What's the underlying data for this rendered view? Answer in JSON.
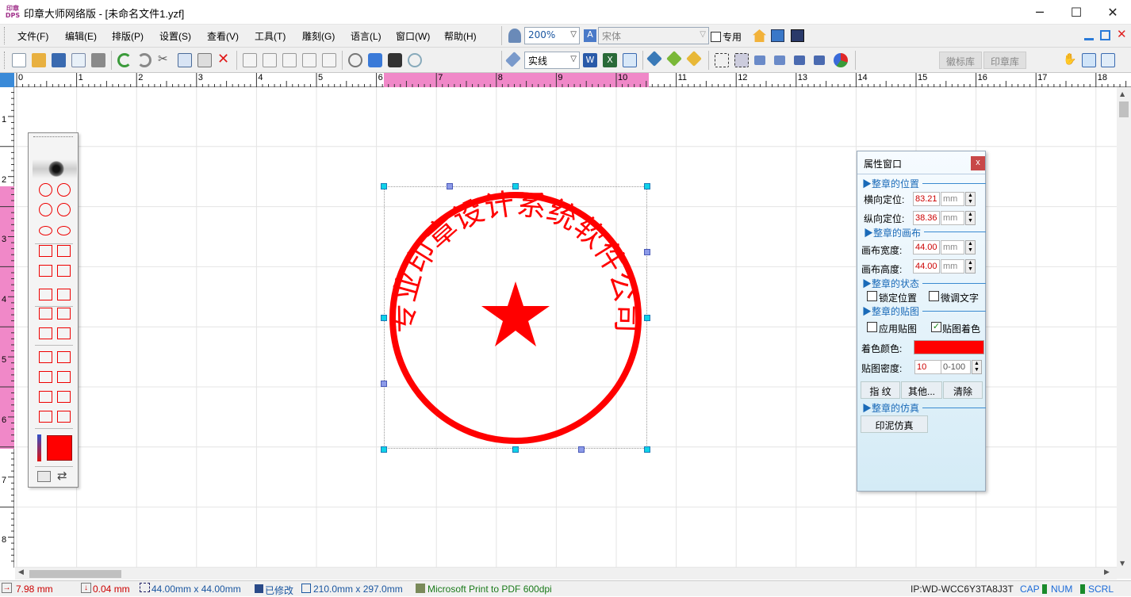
{
  "window": {
    "app_icon_text": "印章\nDPS",
    "title": "印章大师网络版 - [未命名文件1.yzf]",
    "controls": {
      "minimize": "─",
      "maximize": "☐",
      "close": "✕"
    }
  },
  "menu": {
    "items": [
      "文件(F)",
      "编辑(E)",
      "排版(P)",
      "设置(S)",
      "查看(V)",
      "工具(T)",
      "雕刻(G)",
      "语言(L)",
      "窗口(W)",
      "帮助(H)"
    ],
    "zoom": "200%",
    "font": "宋体",
    "dedicated_label": "专用"
  },
  "toolbar": {
    "line_style": "实线",
    "tabs": [
      "徽标库",
      "印章库"
    ]
  },
  "ruler": {
    "h_ticks": [
      "0",
      "1",
      "2",
      "3",
      "4",
      "5",
      "6",
      "7",
      "8",
      "9",
      "10",
      "11",
      "12",
      "13",
      "14",
      "15",
      "16",
      "17",
      "18"
    ],
    "v_ticks": [
      "1",
      "2",
      "3",
      "4",
      "5",
      "6",
      "7",
      "8"
    ]
  },
  "seal": {
    "text": "专业印章设计系统软件公司",
    "color": "#ff0000"
  },
  "properties": {
    "title": "属性窗口",
    "close": "x",
    "sec_position": "▶整章的位置",
    "h_pos_label": "横向定位:",
    "h_pos_value": "83.21",
    "v_pos_label": "纵向定位:",
    "v_pos_value": "38.36",
    "unit": "mm",
    "sec_canvas": "▶整章的画布",
    "width_label": "画布宽度:",
    "width_value": "44.00",
    "height_label": "画布高度:",
    "height_value": "44.00",
    "sec_state": "▶整章的状态",
    "lock_label": "锁定位置",
    "fine_label": "微调文字",
    "sec_texture": "▶整章的贴图",
    "apply_texture_label": "应用贴图",
    "texture_color_label": "贴图着色",
    "color_label": "着色颜色:",
    "density_label": "贴图密度:",
    "density_value": "10",
    "density_range": "0-100",
    "btn_fingerprint": "指  纹",
    "btn_other": "其他...",
    "btn_clear": "清除",
    "sec_sim": "▶整章的仿真",
    "btn_sim": "印泥仿真",
    "accent": "#1a6ab8"
  },
  "status": {
    "x": "7.98 mm",
    "y": "0.04 mm",
    "size": "44.00mm x 44.00mm",
    "modified": "已修改",
    "paper": "210.0mm x 297.0mm",
    "printer": "Microsoft Print to PDF 600dpi",
    "ip": "IP:WD-WCC6Y3TA8J3T",
    "cap": "CAP",
    "num": "NUM",
    "scrl": "SCRL"
  }
}
